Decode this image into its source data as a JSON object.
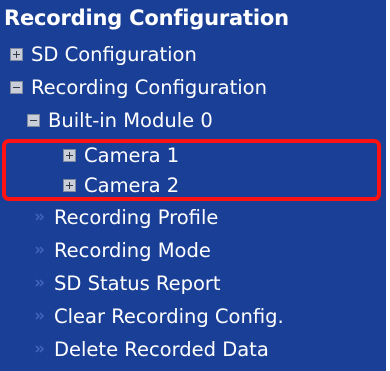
{
  "header": {
    "title": "Recording Configuration"
  },
  "tree": {
    "sd_configuration": {
      "label": "SD Configuration",
      "icon": "expand-plus-icon"
    },
    "recording_configuration": {
      "label": "Recording Configuration",
      "icon": "collapse-minus-icon"
    },
    "builtin_module": {
      "label": "Built-in Module 0",
      "icon": "collapse-minus-icon"
    },
    "camera_1": {
      "label": "Camera 1",
      "icon": "expand-plus-icon"
    },
    "camera_2": {
      "label": "Camera 2",
      "icon": "expand-plus-icon"
    }
  },
  "links": {
    "recording_profile": {
      "label": "Recording Profile",
      "icon": "double-chevron-icon"
    },
    "recording_mode": {
      "label": "Recording Mode",
      "icon": "double-chevron-icon"
    },
    "sd_status_report": {
      "label": "SD Status Report",
      "icon": "double-chevron-icon"
    },
    "clear_recording_config": {
      "label": "Clear Recording Config.",
      "icon": "double-chevron-icon"
    },
    "delete_recorded_data": {
      "label": "Delete Recorded Data",
      "icon": "double-chevron-icon"
    }
  },
  "colors": {
    "panel_background": "#1a3f96",
    "text": "#ffffff",
    "highlight_border": "#ff1212"
  }
}
